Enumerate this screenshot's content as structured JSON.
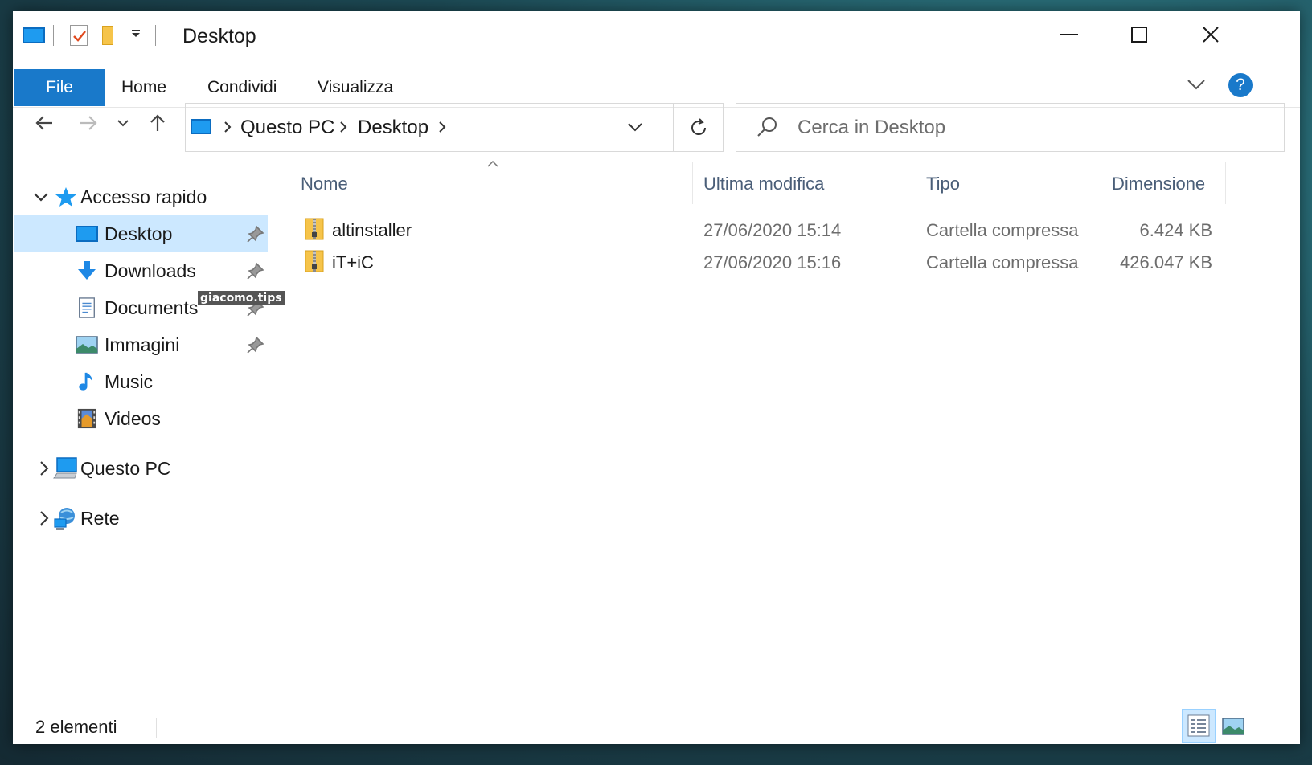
{
  "window": {
    "title": "Desktop",
    "minimize_icon": "minimize-icon",
    "maximize_icon": "maximize-icon",
    "close_icon": "close-icon"
  },
  "ribbon": {
    "tabs": [
      "File",
      "Home",
      "Condividi",
      "Visualizza"
    ],
    "accent": "#1979ca"
  },
  "address": {
    "crumbs": [
      "Questo PC",
      "Desktop"
    ]
  },
  "search": {
    "placeholder": "Cerca in Desktop"
  },
  "nav": {
    "quick_access": "Accesso rapido",
    "items": [
      {
        "label": "Desktop",
        "icon": "desktop-icon",
        "pinned": true,
        "selected": true
      },
      {
        "label": "Downloads",
        "icon": "downloads-icon",
        "pinned": true
      },
      {
        "label": "Documents",
        "icon": "documents-icon",
        "pinned": true
      },
      {
        "label": "Immagini",
        "icon": "pictures-icon",
        "pinned": true
      },
      {
        "label": "Music",
        "icon": "music-icon",
        "pinned": false
      },
      {
        "label": "Videos",
        "icon": "videos-icon",
        "pinned": false
      }
    ],
    "this_pc": "Questo PC",
    "network": "Rete",
    "selected_bg": "#cce8ff"
  },
  "columns": [
    "Nome",
    "Ultima modifica",
    "Tipo",
    "Dimensione"
  ],
  "files": [
    {
      "name": "altinstaller",
      "modified": "27/06/2020 15:14",
      "type": "Cartella compressa",
      "size": "6.424 KB"
    },
    {
      "name": "iT+iC",
      "modified": "27/06/2020 15:16",
      "type": "Cartella compressa",
      "size": "426.047 KB"
    }
  ],
  "status": {
    "count": "2 elementi"
  },
  "watermark": "giacomo.tips"
}
